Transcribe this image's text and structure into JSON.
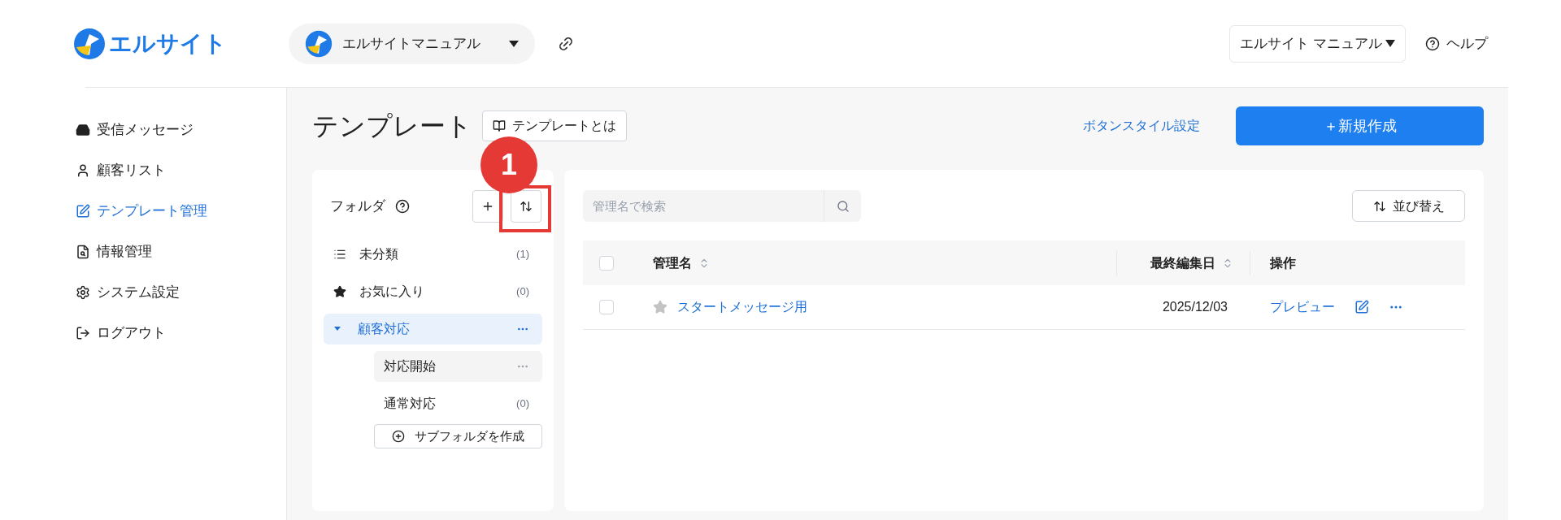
{
  "brand": {
    "name": "エルサイト"
  },
  "workspace": {
    "name": "エルサイトマニュアル"
  },
  "account_menu": {
    "label": "エルサイト マニュアル"
  },
  "help": {
    "label": "ヘルプ"
  },
  "nav": [
    {
      "label": "受信メッセージ",
      "selected": false
    },
    {
      "label": "顧客リスト",
      "selected": false
    },
    {
      "label": "テンプレート管理",
      "selected": true
    },
    {
      "label": "情報管理",
      "selected": false
    },
    {
      "label": "システム設定",
      "selected": false
    },
    {
      "label": "ログアウト",
      "selected": false
    }
  ],
  "page": {
    "title": "テンプレート",
    "about_button": "テンプレートとは",
    "style_link": "ボタンスタイル設定",
    "new_button": "＋新規作成"
  },
  "folders": {
    "title": "フォルダ",
    "items": [
      {
        "kind": "unsorted",
        "label": "未分類",
        "count": "(1)",
        "selected": false
      },
      {
        "kind": "favorites",
        "label": "お気に入り",
        "count": "(0)",
        "selected": false
      },
      {
        "kind": "folder",
        "label": "顧客対応",
        "selected": true,
        "expanded": true,
        "children": [
          {
            "label": "対応開始",
            "selected": false,
            "hovered": true
          },
          {
            "label": "通常対応",
            "count": "(0)",
            "selected": false
          }
        ]
      }
    ],
    "create_subfolder": "サブフォルダを作成"
  },
  "annotation": {
    "number": "1"
  },
  "search": {
    "placeholder": "管理名で検索"
  },
  "sort_button": "並び替え",
  "table": {
    "header_checked": false,
    "columns": [
      {
        "label": "管理名",
        "sortable": true
      },
      {
        "label": "最終編集日",
        "sortable": true
      },
      {
        "label": "操作"
      }
    ],
    "rows": [
      {
        "checked": false,
        "favorite": false,
        "name": "スタートメッセージ用",
        "date": "2025/12/03",
        "preview": "プレビュー"
      }
    ]
  }
}
